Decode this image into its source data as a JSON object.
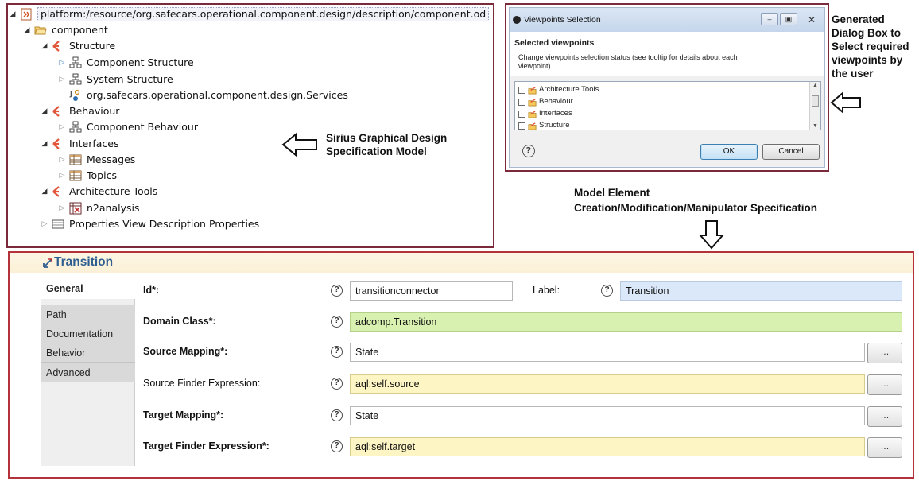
{
  "tree": {
    "root": "platform:/resource/org.safecars.operational.component.design/description/component.od",
    "component": "component",
    "structure": "Structure",
    "component_structure": "Component Structure",
    "system_structure": "System Structure",
    "services": "org.safecars.operational.component.design.Services",
    "behaviour": "Behaviour",
    "component_behaviour": "Component Behaviour",
    "interfaces": "Interfaces",
    "messages": "Messages",
    "topics": "Topics",
    "architecture_tools": "Architecture Tools",
    "n2analysis": "n2analysis",
    "properties_view": "Properties View Description Properties"
  },
  "annotations": {
    "sirius_line1": "Sirius Graphical Design",
    "sirius_line2": "Specification Model",
    "dialog_line1": "Generated",
    "dialog_line2": "Dialog Box to",
    "dialog_line3": "Select required",
    "dialog_line4": "viewpoints by",
    "dialog_line5": "the user",
    "model_line1": "Model Element",
    "model_line2": "Creation/Modification/Manipulator Specification"
  },
  "dialog": {
    "title": "Viewpoints Selection",
    "heading": "Selected viewpoints",
    "description": "Change viewpoints selection status (see tooltip for details about each viewpoint)",
    "viewpoints": [
      "Architecture Tools",
      "Behaviour",
      "Interfaces",
      "Structure"
    ],
    "ok_label": "OK",
    "cancel_label": "Cancel",
    "help_glyph": "?"
  },
  "transition": {
    "title": "Transition",
    "tabs": [
      "General",
      "Path",
      "Documentation",
      "Behavior",
      "Advanced"
    ],
    "active_tab": "General",
    "fields": {
      "id_label": "Id*:",
      "id_value": "transitionconnector",
      "label_label": "Label:",
      "label_value": "Transition",
      "domain_class_label": "Domain Class*:",
      "domain_class_value": "adcomp.Transition",
      "source_mapping_label": "Source Mapping*:",
      "source_mapping_value": "State",
      "source_finder_label": "Source Finder Expression:",
      "source_finder_value": "aql:self.source",
      "target_mapping_label": "Target Mapping*:",
      "target_mapping_value": "State",
      "target_finder_label": "Target Finder Expression*:",
      "target_finder_value": "aql:self.target"
    },
    "help_glyph": "?",
    "browse_label": "..."
  },
  "colors": {
    "frame_dark_red": "#7a2a3a",
    "frame_red": "#b4323a",
    "title_blue": "#2e5d8f",
    "domain_green": "#d8f0b0",
    "expression_yellow": "#fdf5c4",
    "label_blue": "#dbe8f9"
  }
}
